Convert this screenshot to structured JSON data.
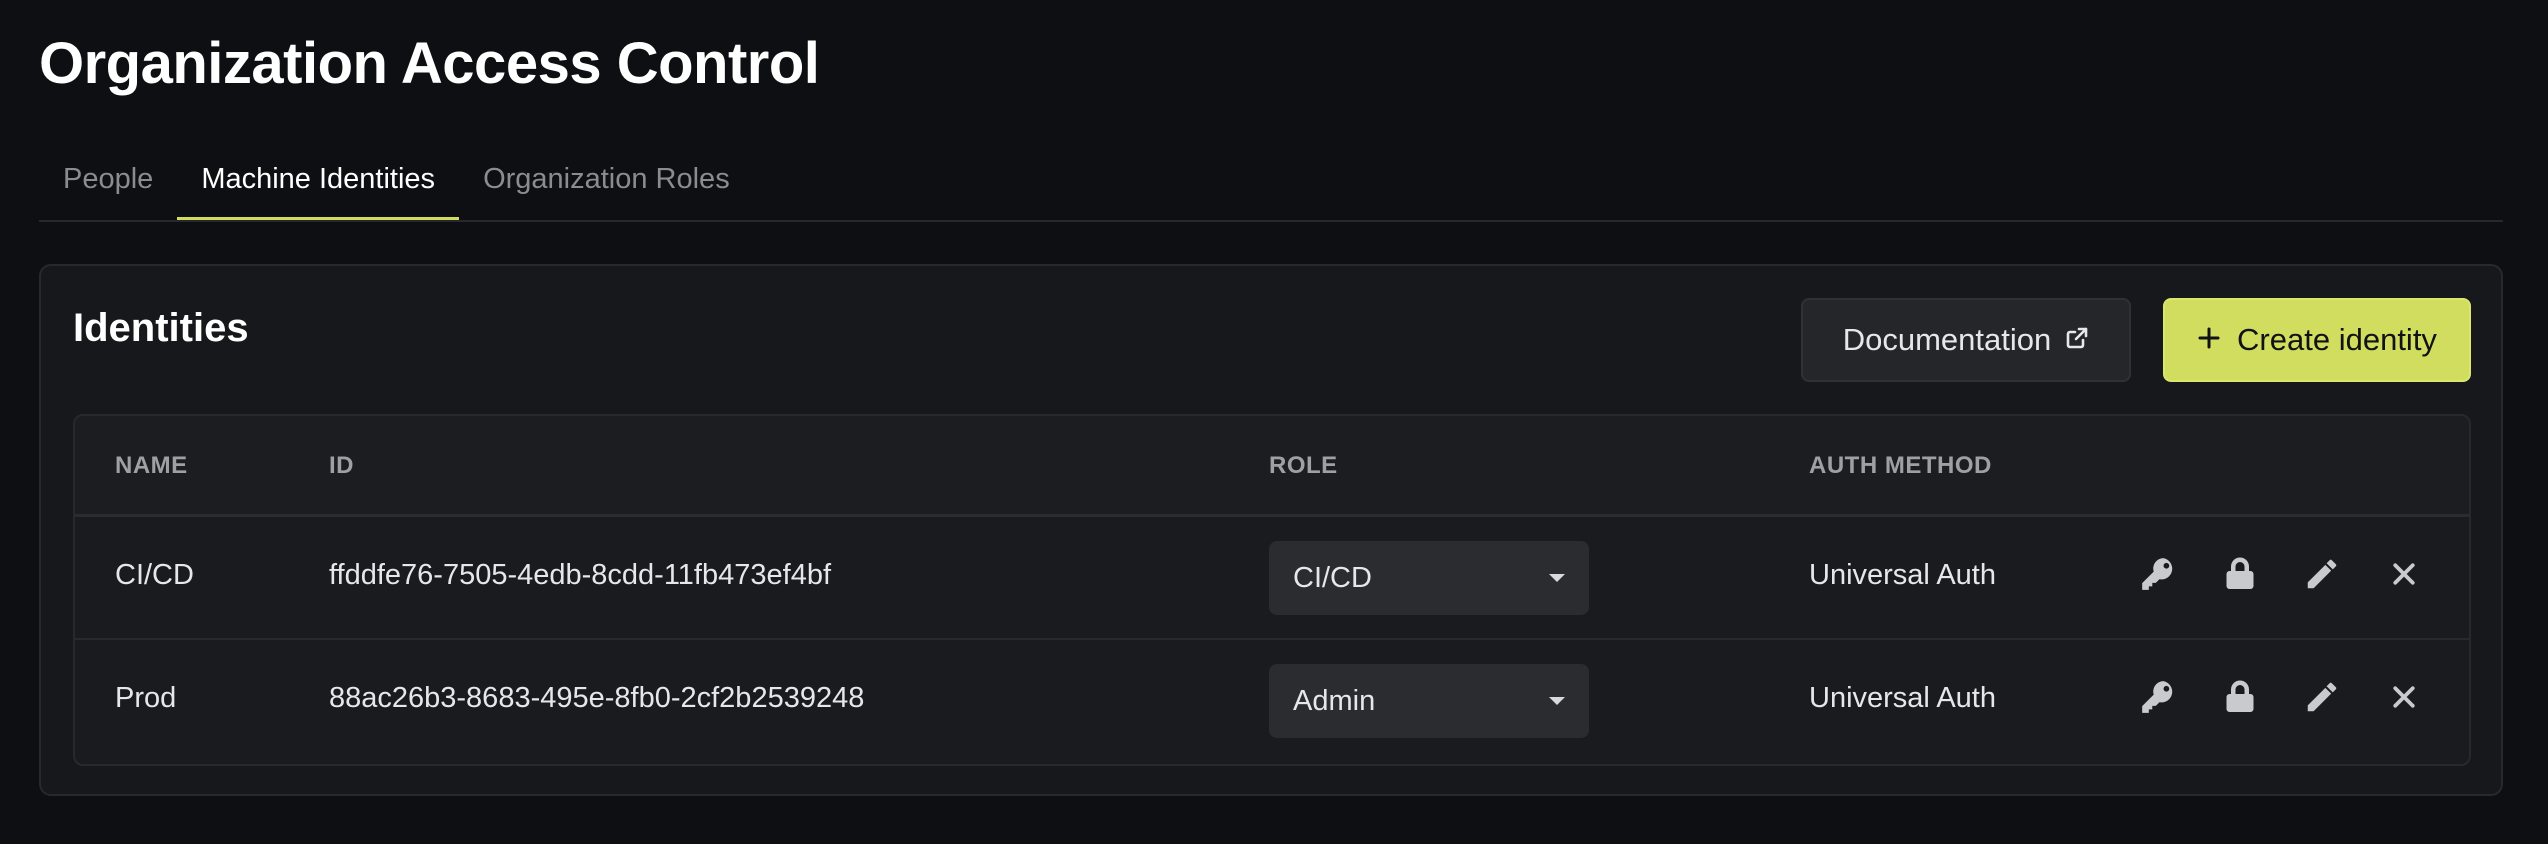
{
  "page": {
    "title": "Organization Access Control"
  },
  "tabs": [
    {
      "label": "People",
      "active": false
    },
    {
      "label": "Machine Identities",
      "active": true
    },
    {
      "label": "Organization Roles",
      "active": false
    }
  ],
  "identities": {
    "title": "Identities",
    "documentation_label": "Documentation",
    "create_label": "Create identity",
    "columns": {
      "name": "NAME",
      "id": "ID",
      "role": "ROLE",
      "auth_method": "AUTH METHOD"
    },
    "rows": [
      {
        "name": "CI/CD",
        "id": "ffddfe76-7505-4edb-8cdd-11fb473ef4bf",
        "role": "CI/CD",
        "auth_method": "Universal Auth"
      },
      {
        "name": "Prod",
        "id": "88ac26b3-8683-495e-8fb0-2cf2b2539248",
        "role": "Admin",
        "auth_method": "Universal Auth"
      }
    ],
    "row_actions": [
      "key-icon",
      "lock-icon",
      "pencil-icon",
      "close-icon"
    ]
  },
  "colors": {
    "accent": "#d1dd5f",
    "background": "#0e0f12",
    "card": "#17181b"
  }
}
